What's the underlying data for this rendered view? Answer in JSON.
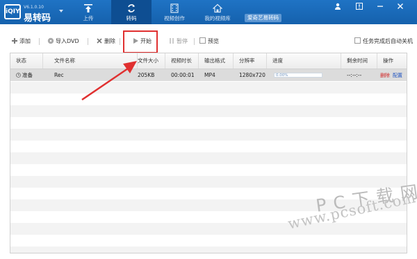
{
  "app": {
    "logo_text": "iQIY",
    "version": "V6.1.0.10",
    "name": "易转码"
  },
  "nav": {
    "tabs": [
      {
        "label": "上传",
        "icon": "upload-icon",
        "active": false
      },
      {
        "label": "转码",
        "icon": "convert-icon",
        "active": true
      },
      {
        "label": "视频创作",
        "icon": "video-edit-icon",
        "active": false
      },
      {
        "label": "我的视频库",
        "icon": "home-icon",
        "active": false
      }
    ],
    "brand_pill": "爱奇艺易转码"
  },
  "window_controls": [
    "user-icon",
    "info-icon",
    "minimize-icon",
    "close-icon"
  ],
  "toolbar": {
    "add": "添加",
    "import_dvd": "导入DVD",
    "delete": "删除",
    "start": "开始",
    "pause": "暂停",
    "preview": "预览",
    "auto_shutdown": "任务完成后自动关机"
  },
  "table": {
    "columns": [
      "状态",
      "文件名称",
      "文件大小",
      "视频时长",
      "输出格式",
      "分辨率",
      "进度",
      "剩余时间",
      "操作"
    ],
    "rows": [
      {
        "status": "准备",
        "name": "Rec",
        "size": "205KB",
        "duration": "00:00:01",
        "format": "MP4",
        "resolution": "1280x720",
        "progress_text": "0.00%",
        "progress": 0,
        "remaining": "--:--:--",
        "action_delete": "删除",
        "action_config": "配置"
      }
    ]
  },
  "watermark": {
    "big": "PC下载网",
    "small": "www.pcsoft.com.cn"
  },
  "colors": {
    "topbar": "#1a68b8",
    "active_tab": "#0e4e92",
    "highlight": "#e03030",
    "delete_action": "#d02020",
    "config_action": "#1a4fbf"
  }
}
